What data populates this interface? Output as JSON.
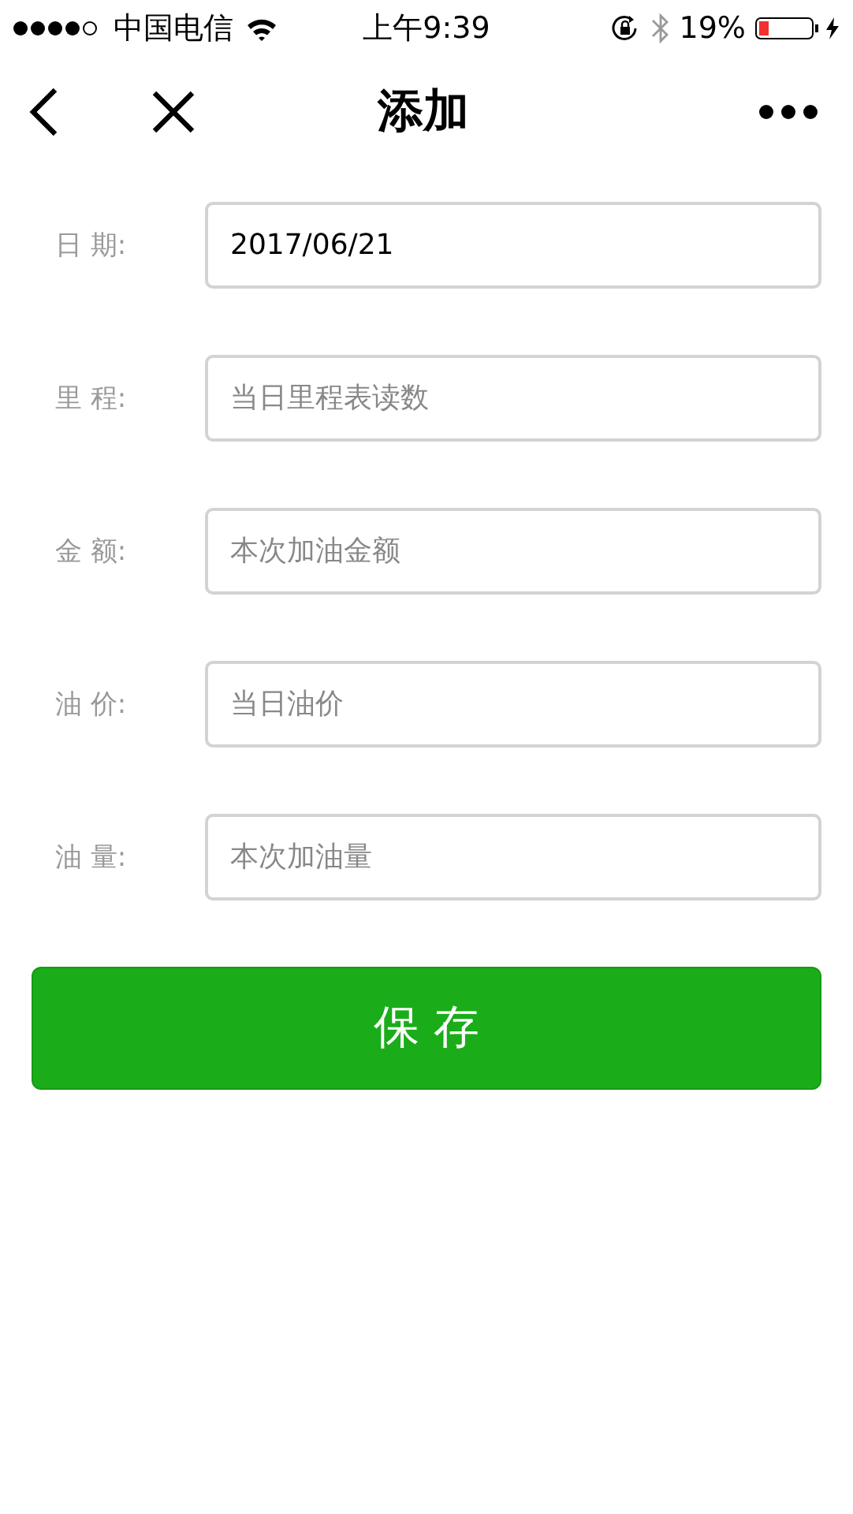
{
  "status_bar": {
    "carrier": "中国电信",
    "time": "上午9:39",
    "battery": "19%"
  },
  "nav_bar": {
    "title": "添加"
  },
  "form": {
    "fields": [
      {
        "label": "日 期:",
        "value": "2017/06/21"
      },
      {
        "label": "里 程:",
        "placeholder": "当日里程表读数"
      },
      {
        "label": "金 额:",
        "placeholder": "本次加油金额"
      },
      {
        "label": "油 价:",
        "placeholder": "当日油价"
      },
      {
        "label": "油 量:",
        "placeholder": "本次加油量"
      }
    ]
  },
  "save_button": {
    "label": "保 存"
  }
}
